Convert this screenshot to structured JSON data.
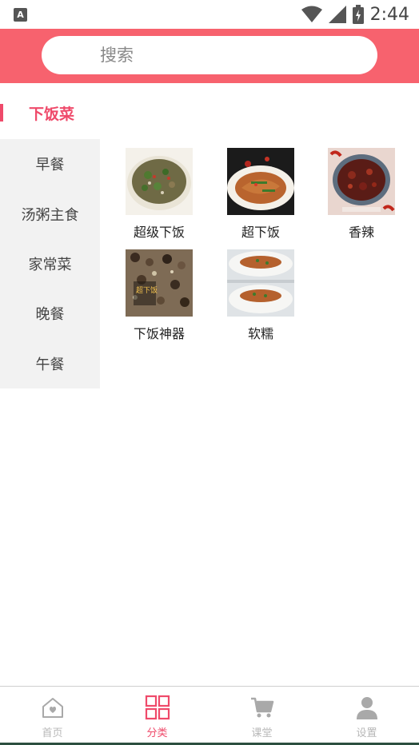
{
  "status_bar": {
    "app_badge": "A",
    "time": "2:44"
  },
  "search": {
    "placeholder": "搜索"
  },
  "section": {
    "title": "下饭菜"
  },
  "sidebar": {
    "items": [
      {
        "label": "早餐"
      },
      {
        "label": "汤粥主食"
      },
      {
        "label": "家常菜"
      },
      {
        "label": "晚餐"
      },
      {
        "label": "午餐"
      }
    ]
  },
  "grid": {
    "items": [
      {
        "label": "超级下饭",
        "image": "stir-fried-greens-plate"
      },
      {
        "label": "超下饭",
        "image": "braised-fish-plate"
      },
      {
        "label": "香辣",
        "image": "spicy-chili-bowl"
      },
      {
        "label": "下饭神器",
        "image": "minced-meat-bowl"
      },
      {
        "label": "软糯",
        "image": "rice-with-topping"
      }
    ],
    "thumb_overlay_text": "超下饭"
  },
  "bottom_nav": {
    "items": [
      {
        "label": "首页",
        "icon": "home-icon"
      },
      {
        "label": "分类",
        "icon": "category-grid-icon"
      },
      {
        "label": "课堂",
        "icon": "cart-icon"
      },
      {
        "label": "设置",
        "icon": "user-icon"
      }
    ],
    "active_index": 1
  },
  "colors": {
    "brand": "#f7626e",
    "accent": "#ef4a6a",
    "sidebar_bg": "#f2f2f2",
    "nav_inactive": "#b8b8b8"
  }
}
